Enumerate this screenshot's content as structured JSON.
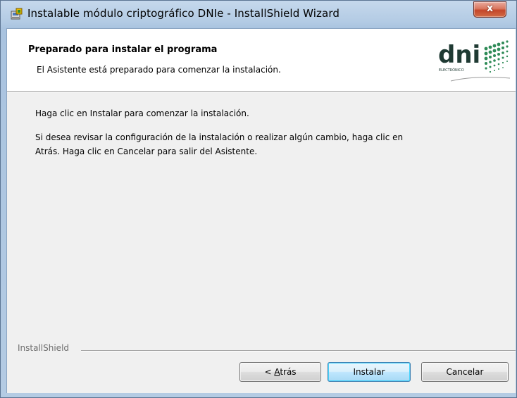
{
  "window": {
    "title": "Instalable módulo criptográfico DNIe - InstallShield Wizard",
    "close_label": "x",
    "title_icon": "installer-icon"
  },
  "header": {
    "title": "Preparado para instalar el programa",
    "subtitle": "El Asistente está preparado para comenzar la instalación.",
    "logo": {
      "main_text": "dni",
      "sub_text": "ELECTRÓNICO"
    }
  },
  "body": {
    "line1": "Haga clic en Instalar para comenzar la instalación.",
    "line2": "Si desea revisar la configuración de la instalación o realizar algún cambio, haga clic en",
    "line3": "Atrás. Haga clic en Cancelar para salir del Asistente."
  },
  "footer": {
    "group_label": "InstallShield"
  },
  "buttons": {
    "back_prefix": "< ",
    "back_mnemonic": "A",
    "back_rest": "trás",
    "install": "Instalar",
    "cancel": "Cancelar"
  },
  "colors": {
    "title_bar": "#b3cbe4",
    "close_button": "#c4462a",
    "default_button_border": "#3c7fb1",
    "logo_text": "#1f3a33",
    "logo_dots": "#2e8b57"
  }
}
